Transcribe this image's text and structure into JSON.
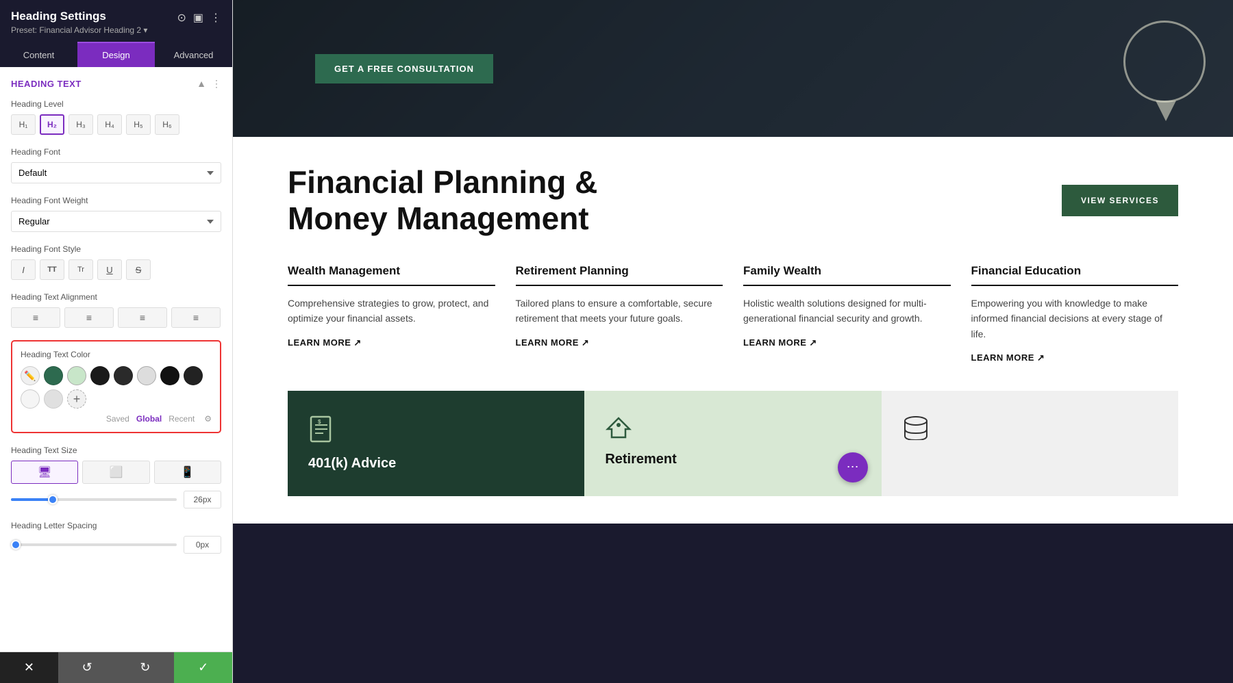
{
  "panel": {
    "title": "Heading Settings",
    "preset": "Preset: Financial Advisor Heading 2 ▾",
    "tabs": [
      {
        "id": "content",
        "label": "Content",
        "active": false
      },
      {
        "id": "design",
        "label": "Design",
        "active": true
      },
      {
        "id": "advanced",
        "label": "Advanced",
        "active": false
      }
    ],
    "section_title": "Heading Text",
    "heading_level": {
      "label": "Heading Level",
      "levels": [
        "H1",
        "H2",
        "H3",
        "H4",
        "H5",
        "H6"
      ],
      "active": "H2"
    },
    "heading_font": {
      "label": "Heading Font",
      "value": "Default"
    },
    "heading_font_weight": {
      "label": "Heading Font Weight",
      "value": "Regular"
    },
    "heading_font_style": {
      "label": "Heading Font Style",
      "styles": [
        "I",
        "TT",
        "Tr",
        "U",
        "S"
      ]
    },
    "heading_text_alignment": {
      "label": "Heading Text Alignment",
      "options": [
        "left",
        "center",
        "right",
        "justify"
      ]
    },
    "heading_text_color": {
      "label": "Heading Text Color",
      "swatches": [
        {
          "color": "#2d6a4f",
          "type": "solid"
        },
        {
          "color": "#3a7d44",
          "type": "solid"
        },
        {
          "color": "#f0f0f0",
          "type": "light"
        },
        {
          "color": "#1a1a1a",
          "type": "solid"
        },
        {
          "color": "#2a2a2a",
          "type": "solid"
        },
        {
          "color": "#ddd",
          "type": "light"
        },
        {
          "color": "#111",
          "type": "solid"
        },
        {
          "color": "#222",
          "type": "solid"
        }
      ],
      "row2": [
        {
          "color": "#f5f5f5",
          "type": "empty"
        },
        {
          "color": "#e0e0e0",
          "type": "light"
        }
      ],
      "tabs": [
        "Saved",
        "Global",
        "Recent"
      ],
      "active_tab": "Global"
    },
    "heading_text_size": {
      "label": "Heading Text Size",
      "devices": [
        "desktop",
        "tablet",
        "mobile"
      ],
      "active_device": "desktop",
      "value": "26px",
      "slider_pct": 25
    },
    "heading_letter_spacing": {
      "label": "Heading Letter Spacing",
      "value": "0px",
      "slider_pct": 0
    },
    "footer": {
      "cancel_label": "✕",
      "undo_label": "↺",
      "redo_label": "↻",
      "save_label": "✓"
    }
  },
  "preview": {
    "consultation_btn": "GET A FREE CONSULTATION",
    "main_headline_line1": "Financial Planning &",
    "main_headline_line2": "Money Management",
    "view_services_btn": "VIEW SERVICES",
    "services": [
      {
        "title": "Wealth Management",
        "description": "Comprehensive strategies to grow, protect, and optimize your financial assets.",
        "learn_more": "LEARN MORE"
      },
      {
        "title": "Retirement Planning",
        "description": "Tailored plans to ensure a comfortable, secure retirement that meets your future goals.",
        "learn_more": "LEARN MORE"
      },
      {
        "title": "Family Wealth",
        "description": "Holistic wealth solutions designed for multi-generational financial security and growth.",
        "learn_more": "LEARN MORE"
      },
      {
        "title": "Financial Education",
        "description": "Empowering you with knowledge to make informed financial decisions at every stage of life.",
        "learn_more": "LEARN MORE"
      }
    ],
    "cards": [
      {
        "theme": "dark",
        "icon": "📄",
        "title": "401(k) Advice"
      },
      {
        "theme": "light-green",
        "icon": "💰",
        "title": "Retirement"
      },
      {
        "theme": "white",
        "icon": "🪙",
        "title": ""
      }
    ]
  }
}
